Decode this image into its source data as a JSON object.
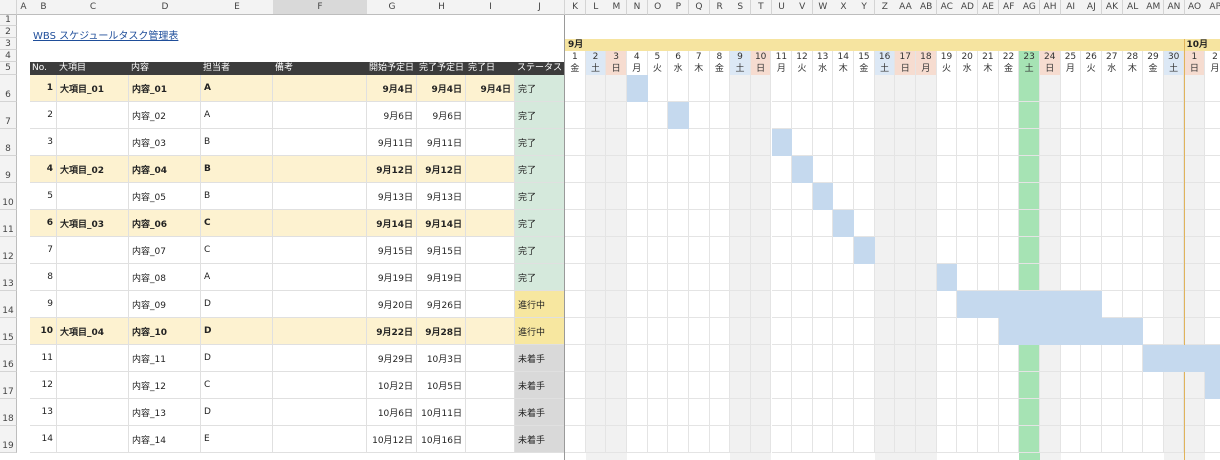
{
  "title": "WBS スケジュールタスク管理表",
  "left_columns": [
    "A",
    "B",
    "C",
    "D",
    "E",
    "F",
    "G",
    "H",
    "I",
    "J"
  ],
  "gantt_columns": [
    "K",
    "L",
    "M",
    "N",
    "O",
    "P",
    "Q",
    "R",
    "S",
    "T",
    "U",
    "V",
    "W",
    "X",
    "Y",
    "Z",
    "AA",
    "AB",
    "AC",
    "AD",
    "AE",
    "AF",
    "AG",
    "AH",
    "AI",
    "AJ",
    "AK",
    "AL",
    "AM",
    "AN",
    "AO",
    "AP"
  ],
  "row_numbers": [
    "1",
    "2",
    "3",
    "4",
    "5",
    "6",
    "7",
    "8",
    "9",
    "10",
    "11",
    "12",
    "13",
    "14",
    "15",
    "16",
    "17",
    "18",
    "19"
  ],
  "headers": [
    "No.",
    "大項目",
    "内容",
    "担当者",
    "備考",
    "開始予定日",
    "完了予定日",
    "完了日",
    "ステータス"
  ],
  "months": {
    "sep": "9月",
    "oct": "10月"
  },
  "days": [
    {
      "d": "1",
      "w": "金",
      "t": "n"
    },
    {
      "d": "2",
      "w": "土",
      "t": "sat"
    },
    {
      "d": "3",
      "w": "日",
      "t": "sun"
    },
    {
      "d": "4",
      "w": "月",
      "t": "n"
    },
    {
      "d": "5",
      "w": "火",
      "t": "n"
    },
    {
      "d": "6",
      "w": "水",
      "t": "n"
    },
    {
      "d": "7",
      "w": "木",
      "t": "n"
    },
    {
      "d": "8",
      "w": "金",
      "t": "n"
    },
    {
      "d": "9",
      "w": "土",
      "t": "sat"
    },
    {
      "d": "10",
      "w": "日",
      "t": "sun"
    },
    {
      "d": "11",
      "w": "月",
      "t": "n"
    },
    {
      "d": "12",
      "w": "火",
      "t": "n"
    },
    {
      "d": "13",
      "w": "水",
      "t": "n"
    },
    {
      "d": "14",
      "w": "木",
      "t": "n"
    },
    {
      "d": "15",
      "w": "金",
      "t": "n"
    },
    {
      "d": "16",
      "w": "土",
      "t": "sat"
    },
    {
      "d": "17",
      "w": "日",
      "t": "sun"
    },
    {
      "d": "18",
      "w": "月",
      "t": "hol"
    },
    {
      "d": "19",
      "w": "火",
      "t": "n"
    },
    {
      "d": "20",
      "w": "水",
      "t": "n"
    },
    {
      "d": "21",
      "w": "木",
      "t": "n"
    },
    {
      "d": "22",
      "w": "金",
      "t": "n"
    },
    {
      "d": "23",
      "w": "土",
      "t": "today"
    },
    {
      "d": "24",
      "w": "日",
      "t": "sun"
    },
    {
      "d": "25",
      "w": "月",
      "t": "n"
    },
    {
      "d": "26",
      "w": "火",
      "t": "n"
    },
    {
      "d": "27",
      "w": "水",
      "t": "n"
    },
    {
      "d": "28",
      "w": "木",
      "t": "n"
    },
    {
      "d": "29",
      "w": "金",
      "t": "n"
    },
    {
      "d": "30",
      "w": "土",
      "t": "sat"
    },
    {
      "d": "1",
      "w": "日",
      "t": "sun"
    },
    {
      "d": "2",
      "w": "月",
      "t": "n"
    }
  ],
  "tasks": [
    {
      "no": "1",
      "major": "大項目_01",
      "content": "内容_01",
      "owner": "A",
      "start": "9月4日",
      "end": "9月4日",
      "done": "9月4日",
      "status": "完了",
      "hl": true,
      "bar": [
        3,
        3
      ]
    },
    {
      "no": "2",
      "major": "",
      "content": "内容_02",
      "owner": "A",
      "start": "9月6日",
      "end": "9月6日",
      "done": "",
      "status": "完了",
      "hl": false,
      "bar": [
        5,
        5
      ]
    },
    {
      "no": "3",
      "major": "",
      "content": "内容_03",
      "owner": "B",
      "start": "9月11日",
      "end": "9月11日",
      "done": "",
      "status": "完了",
      "hl": false,
      "bar": [
        10,
        10
      ]
    },
    {
      "no": "4",
      "major": "大項目_02",
      "content": "内容_04",
      "owner": "B",
      "start": "9月12日",
      "end": "9月12日",
      "done": "",
      "status": "完了",
      "hl": true,
      "bar": [
        11,
        11
      ]
    },
    {
      "no": "5",
      "major": "",
      "content": "内容_05",
      "owner": "B",
      "start": "9月13日",
      "end": "9月13日",
      "done": "",
      "status": "完了",
      "hl": false,
      "bar": [
        12,
        12
      ]
    },
    {
      "no": "6",
      "major": "大項目_03",
      "content": "内容_06",
      "owner": "C",
      "start": "9月14日",
      "end": "9月14日",
      "done": "",
      "status": "完了",
      "hl": true,
      "bar": [
        13,
        13
      ]
    },
    {
      "no": "7",
      "major": "",
      "content": "内容_07",
      "owner": "C",
      "start": "9月15日",
      "end": "9月15日",
      "done": "",
      "status": "完了",
      "hl": false,
      "bar": [
        14,
        14
      ]
    },
    {
      "no": "8",
      "major": "",
      "content": "内容_08",
      "owner": "A",
      "start": "9月19日",
      "end": "9月19日",
      "done": "",
      "status": "完了",
      "hl": false,
      "bar": [
        18,
        18
      ]
    },
    {
      "no": "9",
      "major": "",
      "content": "内容_09",
      "owner": "D",
      "start": "9月20日",
      "end": "9月26日",
      "done": "",
      "status": "進行中",
      "hl": false,
      "bar": [
        19,
        25
      ]
    },
    {
      "no": "10",
      "major": "大項目_04",
      "content": "内容_10",
      "owner": "D",
      "start": "9月22日",
      "end": "9月28日",
      "done": "",
      "status": "進行中",
      "hl": true,
      "bar": [
        21,
        27
      ]
    },
    {
      "no": "11",
      "major": "",
      "content": "内容_11",
      "owner": "D",
      "start": "9月29日",
      "end": "10月3日",
      "done": "",
      "status": "未着手",
      "hl": false,
      "bar": [
        28,
        31
      ]
    },
    {
      "no": "12",
      "major": "",
      "content": "内容_12",
      "owner": "C",
      "start": "10月2日",
      "end": "10月5日",
      "done": "",
      "status": "未着手",
      "hl": false,
      "bar": [
        31,
        31
      ]
    },
    {
      "no": "13",
      "major": "",
      "content": "内容_13",
      "owner": "D",
      "start": "10月6日",
      "end": "10月11日",
      "done": "",
      "status": "未着手",
      "hl": false,
      "bar": null
    },
    {
      "no": "14",
      "major": "",
      "content": "内容_14",
      "owner": "E",
      "start": "10月12日",
      "end": "10月16日",
      "done": "",
      "status": "未着手",
      "hl": false,
      "bar": null
    }
  ],
  "colors": {
    "highlight_row": "#fdf2d0",
    "status_done": "#d5e9dc",
    "status_progress": "#f7e7a0",
    "status_todo": "#d9d9d9",
    "weekend_col": "#f1f1f1",
    "sat_hdr": "#dce8f5",
    "sun_hdr": "#f6dcd0",
    "today": "#a6e3b4",
    "bar": "#c5d9ee",
    "month_band": "#f6e4a0"
  }
}
